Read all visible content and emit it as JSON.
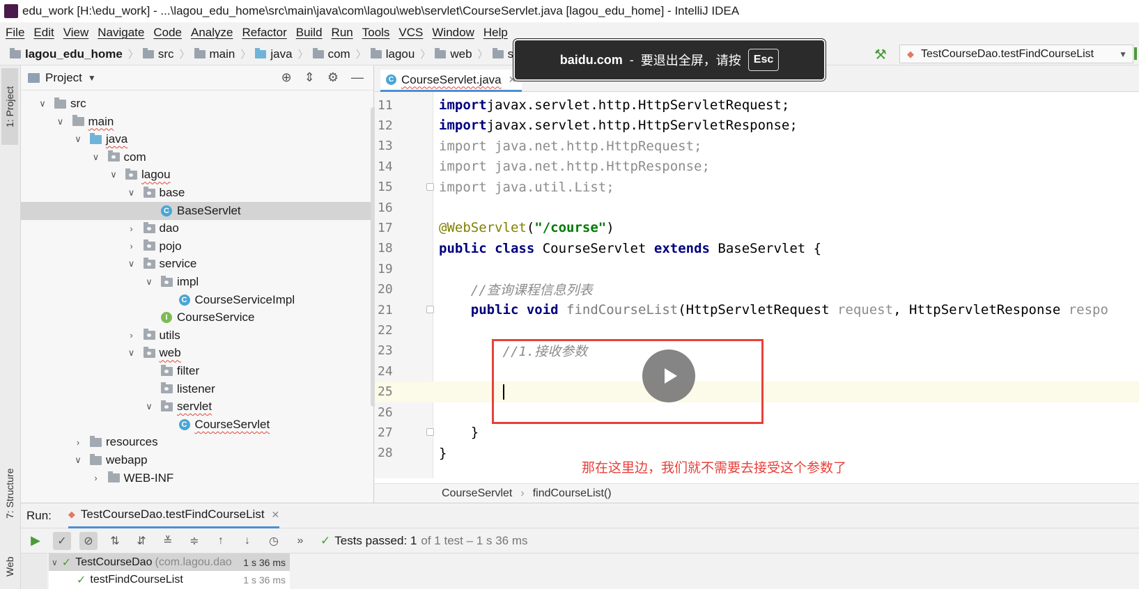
{
  "window": {
    "title": "edu_work [H:\\edu_work] - ...\\lagou_edu_home\\src\\main\\java\\com\\lagou\\web\\servlet\\CourseServlet.java [lagou_edu_home] - IntelliJ IDEA"
  },
  "menu": [
    "File",
    "Edit",
    "View",
    "Navigate",
    "Code",
    "Analyze",
    "Refactor",
    "Build",
    "Run",
    "Tools",
    "VCS",
    "Window",
    "Help"
  ],
  "breadcrumb": [
    "lagou_edu_home",
    "src",
    "main",
    "java",
    "com",
    "lagou",
    "web",
    "servlet"
  ],
  "run_config": "TestCourseDao.testFindCourseList",
  "fullscreen_notice": {
    "site": "baidu.com",
    "dash": "-",
    "message": "要退出全屏，请按",
    "key": "Esc"
  },
  "left_strip": {
    "project_tab": "1: Project",
    "structure_tab": "7: Structure",
    "web_tab": "Web"
  },
  "project_panel": {
    "title": "Project",
    "tree": [
      {
        "label": "src",
        "level": 0,
        "expanded": true,
        "kind": "folder"
      },
      {
        "label": "main",
        "level": 1,
        "expanded": true,
        "kind": "folder"
      },
      {
        "label": "java",
        "level": 2,
        "expanded": true,
        "kind": "folder-blue"
      },
      {
        "label": "com",
        "level": 3,
        "expanded": true,
        "kind": "package"
      },
      {
        "label": "lagou",
        "level": 4,
        "expanded": true,
        "kind": "package"
      },
      {
        "label": "base",
        "level": 5,
        "expanded": true,
        "kind": "package"
      },
      {
        "label": "BaseServlet",
        "level": 6,
        "kind": "class",
        "selected": true
      },
      {
        "label": "dao",
        "level": 5,
        "expanded": false,
        "kind": "package"
      },
      {
        "label": "pojo",
        "level": 5,
        "expanded": false,
        "kind": "package"
      },
      {
        "label": "service",
        "level": 5,
        "expanded": true,
        "kind": "package"
      },
      {
        "label": "impl",
        "level": 6,
        "expanded": true,
        "kind": "package"
      },
      {
        "label": "CourseServiceImpl",
        "level": 7,
        "kind": "class"
      },
      {
        "label": "CourseService",
        "level": 6,
        "kind": "interface"
      },
      {
        "label": "utils",
        "level": 5,
        "expanded": false,
        "kind": "package"
      },
      {
        "label": "web",
        "level": 5,
        "expanded": true,
        "kind": "package"
      },
      {
        "label": "filter",
        "level": 6,
        "kind": "package"
      },
      {
        "label": "listener",
        "level": 6,
        "kind": "package"
      },
      {
        "label": "servlet",
        "level": 6,
        "expanded": true,
        "kind": "package"
      },
      {
        "label": "CourseServlet",
        "level": 7,
        "kind": "class"
      },
      {
        "label": "resources",
        "level": 2,
        "expanded": false,
        "kind": "folder"
      },
      {
        "label": "webapp",
        "level": 2,
        "expanded": true,
        "kind": "folder"
      },
      {
        "label": "WEB-INF",
        "level": 3,
        "expanded": false,
        "kind": "folder"
      }
    ]
  },
  "editor": {
    "tab": "CourseServlet.java",
    "current_line": 25,
    "lines": [
      {
        "n": "11",
        "segs": [
          [
            "kw",
            "import"
          ],
          [
            "",
            "javax.servlet.http.HttpServletRequest;"
          ]
        ]
      },
      {
        "n": "12",
        "segs": [
          [
            "kw",
            "import"
          ],
          [
            "",
            "javax.servlet.http.HttpServletResponse;"
          ]
        ]
      },
      {
        "n": "13",
        "segs": [
          [
            "gray",
            "import java.net.http.HttpRequest;"
          ]
        ]
      },
      {
        "n": "14",
        "segs": [
          [
            "gray",
            "import java.net.http.HttpResponse;"
          ]
        ]
      },
      {
        "n": "15",
        "segs": [
          [
            "gray",
            "import java.util.List;"
          ]
        ]
      },
      {
        "n": "16",
        "segs": []
      },
      {
        "n": "17",
        "segs": [
          [
            "ann",
            "@WebServlet"
          ],
          [
            "",
            "("
          ],
          [
            "str",
            "\"/course\""
          ],
          [
            "",
            ")"
          ]
        ]
      },
      {
        "n": "18",
        "segs": [
          [
            "kw",
            "public class"
          ],
          [
            "",
            " CourseServlet "
          ],
          [
            "kw",
            "extends"
          ],
          [
            "",
            " BaseServlet {"
          ]
        ]
      },
      {
        "n": "19",
        "segs": []
      },
      {
        "n": "20",
        "segs": [
          [
            "",
            "    "
          ],
          [
            "cmt",
            "//查询课程信息列表"
          ]
        ]
      },
      {
        "n": "21",
        "segs": [
          [
            "",
            "    "
          ],
          [
            "kw",
            "public void"
          ],
          [
            "fn",
            " findCourseList"
          ],
          [
            "",
            "(HttpServletRequest "
          ],
          [
            "param",
            "request"
          ],
          [
            "",
            ", HttpServletResponse "
          ],
          [
            "param",
            "respo"
          ]
        ]
      },
      {
        "n": "22",
        "segs": []
      },
      {
        "n": "23",
        "segs": [
          [
            "",
            "        "
          ],
          [
            "cmt",
            "//1.接收参数"
          ]
        ]
      },
      {
        "n": "24",
        "segs": []
      },
      {
        "n": "25",
        "segs": [
          [
            "",
            "        "
          ]
        ],
        "caret": true
      },
      {
        "n": "26",
        "segs": []
      },
      {
        "n": "27",
        "segs": [
          [
            "",
            "    }"
          ]
        ]
      },
      {
        "n": "28",
        "segs": [
          [
            "",
            "}"
          ]
        ]
      }
    ],
    "method_crumb": [
      "CourseServlet",
      "findCourseList()"
    ]
  },
  "subtitle": "那在这里边，我们就不需要去接受这个参数了",
  "run_panel": {
    "label": "Run:",
    "tab": "TestCourseDao.testFindCourseList",
    "status_prefix": "Tests passed:",
    "status_count": "1",
    "status_detail": "of 1 test – 1 s 36 ms",
    "tests": [
      {
        "name": "TestCourseDao",
        "detail": "(com.lagou.dao",
        "time": "1 s 36 ms"
      },
      {
        "name": "testFindCourseList",
        "detail": "",
        "time": "1 s 36 ms"
      }
    ]
  },
  "colors": {
    "accent": "#4a8fd4",
    "highlight_box": "#e8403a",
    "subtitle": "#e8403a",
    "pass": "#4a9a3a"
  }
}
